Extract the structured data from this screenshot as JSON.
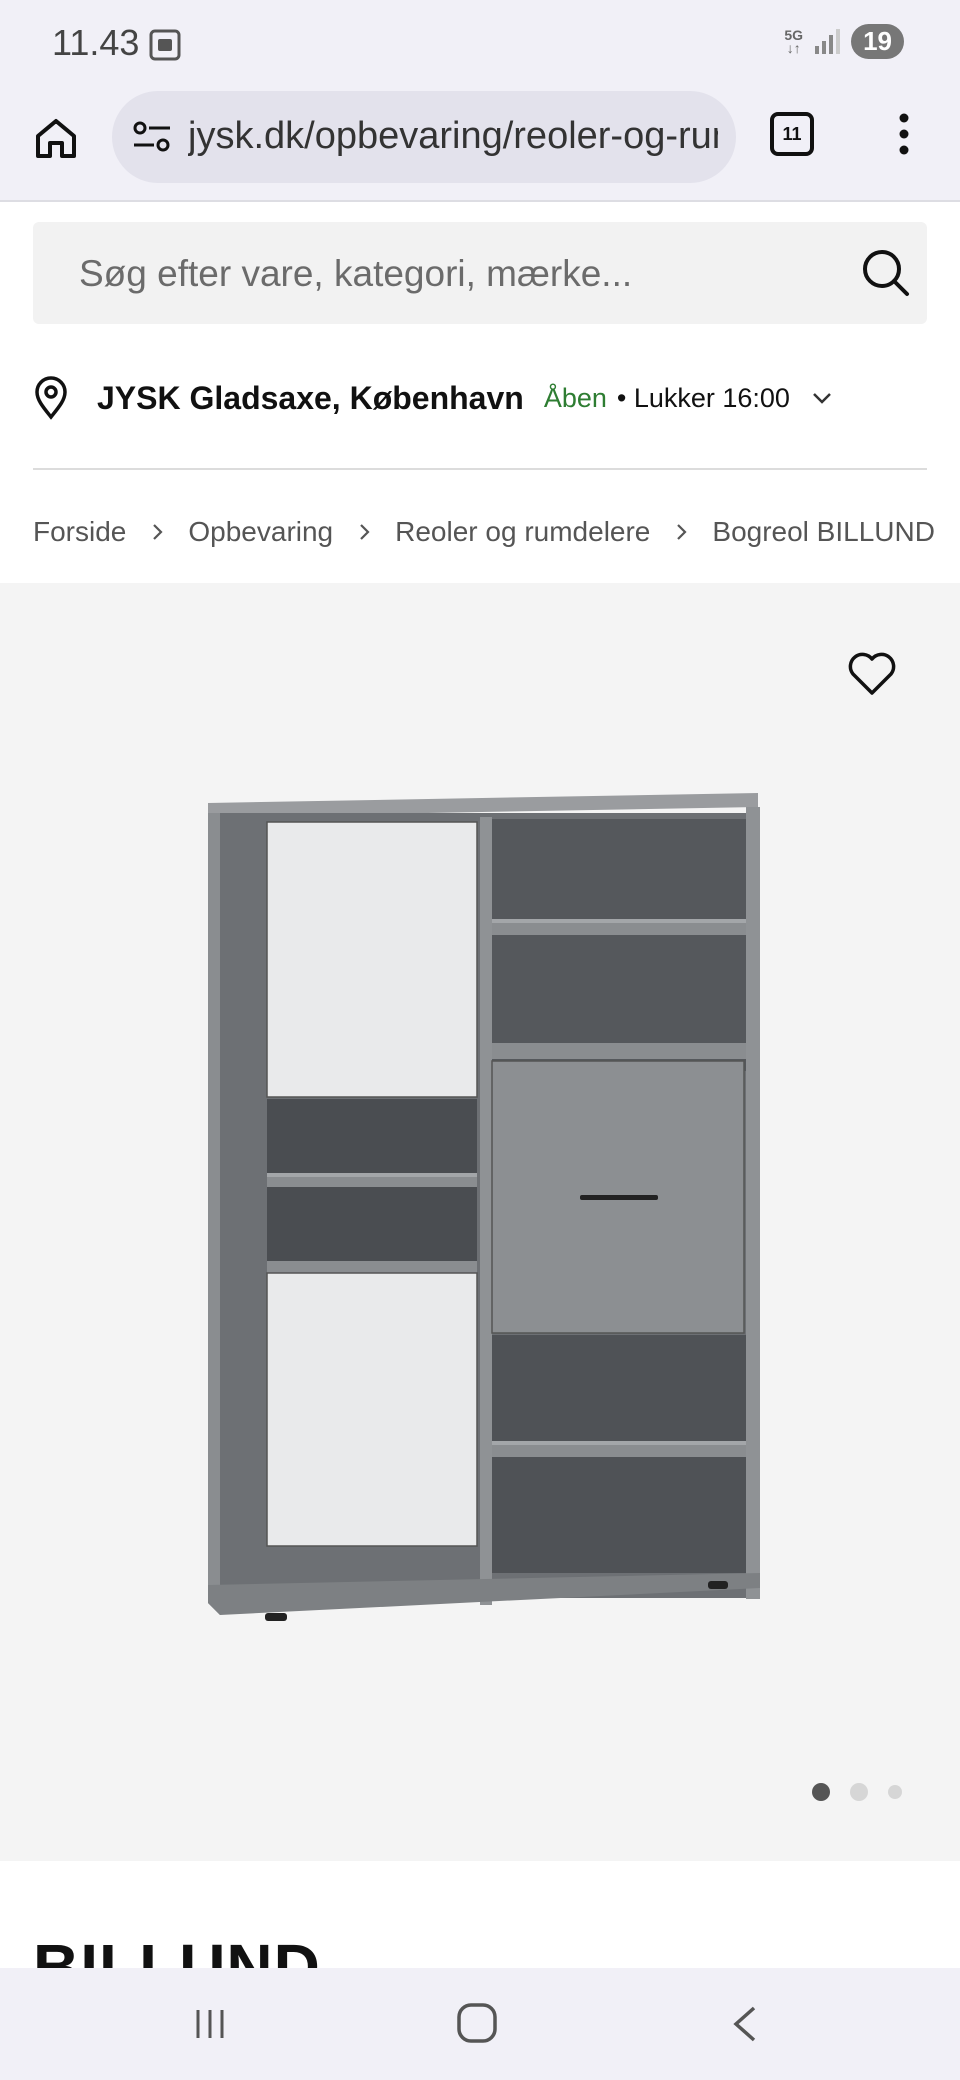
{
  "status_bar": {
    "time": "11.43",
    "network_label_top": "5G",
    "network_label_bottom": "↓↑",
    "battery": "19"
  },
  "browser": {
    "url": "jysk.dk/opbevaring/reoler-og-rumdelere",
    "tab_count": "11"
  },
  "search": {
    "placeholder": "Søg efter vare, kategori, mærke..."
  },
  "store": {
    "name": "JYSK Gladsaxe, København",
    "status": "Åben",
    "closes": "• Lukker 16:00",
    "status_color": "#2e7d32"
  },
  "breadcrumb": [
    "Forside",
    "Opbevaring",
    "Reoler og rumdelere",
    "Bogreol BILLUND"
  ],
  "gallery": {
    "image_count": 3,
    "active_index": 0
  },
  "product": {
    "title": "BILLUND"
  }
}
